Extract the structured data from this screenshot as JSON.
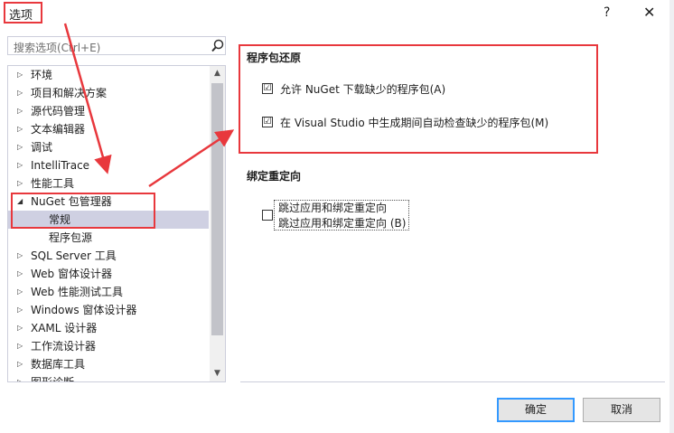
{
  "window": {
    "title": "选项",
    "help": "?",
    "close": "✕"
  },
  "search": {
    "placeholder": "搜索选项(Ctrl+E)"
  },
  "tree": {
    "items": [
      {
        "label": "环境",
        "arrow": "▷"
      },
      {
        "label": "项目和解决方案",
        "arrow": "▷"
      },
      {
        "label": "源代码管理",
        "arrow": "▷"
      },
      {
        "label": "文本编辑器",
        "arrow": "▷"
      },
      {
        "label": "调试",
        "arrow": "▷"
      },
      {
        "label": "IntelliTrace",
        "arrow": "▷"
      },
      {
        "label": "性能工具",
        "arrow": "▷"
      },
      {
        "label": "NuGet 包管理器",
        "arrow": "◢"
      },
      {
        "label": "常规",
        "arrow": ""
      },
      {
        "label": "程序包源",
        "arrow": ""
      },
      {
        "label": "SQL Server 工具",
        "arrow": "▷"
      },
      {
        "label": "Web 窗体设计器",
        "arrow": "▷"
      },
      {
        "label": "Web 性能测试工具",
        "arrow": "▷"
      },
      {
        "label": "Windows 窗体设计器",
        "arrow": "▷"
      },
      {
        "label": "XAML 设计器",
        "arrow": "▷"
      },
      {
        "label": "工作流设计器",
        "arrow": "▷"
      },
      {
        "label": "数据库工具",
        "arrow": "▷"
      },
      {
        "label": "图形诊断",
        "arrow": "▷"
      }
    ]
  },
  "restore": {
    "heading": "程序包还原",
    "option1": {
      "label": "允许 NuGet 下载缺少的程序包(A)",
      "checked": "☑"
    },
    "option2": {
      "label": "在 Visual Studio 中生成期间自动检查缺少的程序包(M)",
      "checked": "☑"
    }
  },
  "binding": {
    "heading": "绑定重定向",
    "option": {
      "line1": "跳过应用和绑定重定向",
      "line2": "跳过应用和绑定重定向 (B)"
    }
  },
  "buttons": {
    "ok": "确定",
    "cancel": "取消"
  },
  "scroll": {
    "up": "▲",
    "down": "▼"
  }
}
